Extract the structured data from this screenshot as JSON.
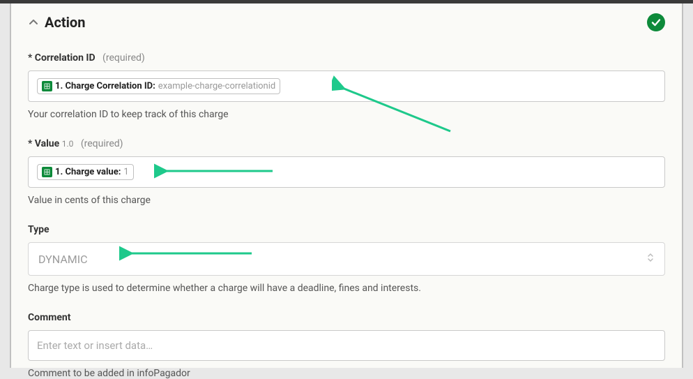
{
  "section": {
    "title": "Action"
  },
  "fields": {
    "correlation": {
      "star": "*",
      "label": "Correlation ID",
      "required": "(required)",
      "pill_label": "1. Charge Correlation ID:",
      "pill_value": "example-charge-correlationid",
      "help": "Your correlation ID to keep track of this charge"
    },
    "value": {
      "star": "*",
      "label": "Value",
      "version": "1.0",
      "required": "(required)",
      "pill_label": "1. Charge value:",
      "pill_value": "1",
      "help": "Value in cents of this charge"
    },
    "type": {
      "label": "Type",
      "selected": "DYNAMIC",
      "help": "Charge type is used to determine whether a charge will have a deadline, fines and interests."
    },
    "comment": {
      "label": "Comment",
      "placeholder": "Enter text or insert data…",
      "help": "Comment to be added in infoPagador"
    }
  }
}
